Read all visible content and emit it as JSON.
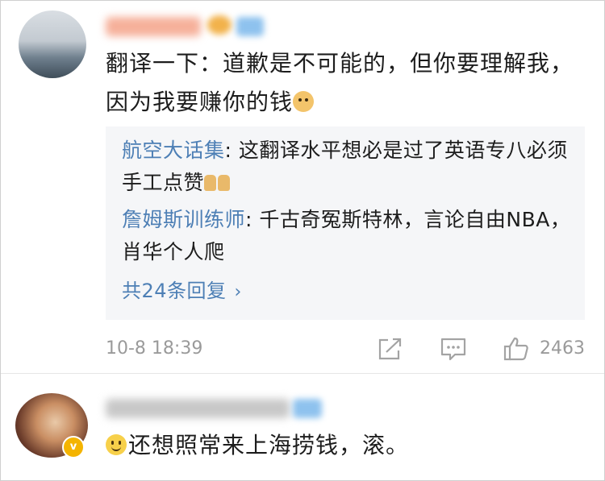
{
  "comments": [
    {
      "text_part1": "翻译一下：道歉是不可能的，但你要理解我，因为我要赚你的钱",
      "emoji": "doge-emoji",
      "replies": [
        {
          "author": "航空大话集",
          "sep": ":",
          "text": " 这翻译水平想必是过了英语专八必须手工点赞",
          "emoji": "thumbs-up-emoji"
        },
        {
          "author": "詹姆斯训练师",
          "sep": ":",
          "text": " 千古奇冤斯特林，言论自由NBA，肖华个人爬"
        }
      ],
      "more_replies_label": "共24条回复",
      "timestamp": "10-8 18:39",
      "like_count": "2463"
    },
    {
      "emoji": "smile-emoji",
      "text": "还想照常来上海捞钱，滚。"
    }
  ],
  "colors": {
    "link_blue": "#4d7fb5",
    "meta_gray": "#9a9a9a",
    "reply_bg": "#f5f6f8",
    "verified_badge": "#f4b400"
  }
}
